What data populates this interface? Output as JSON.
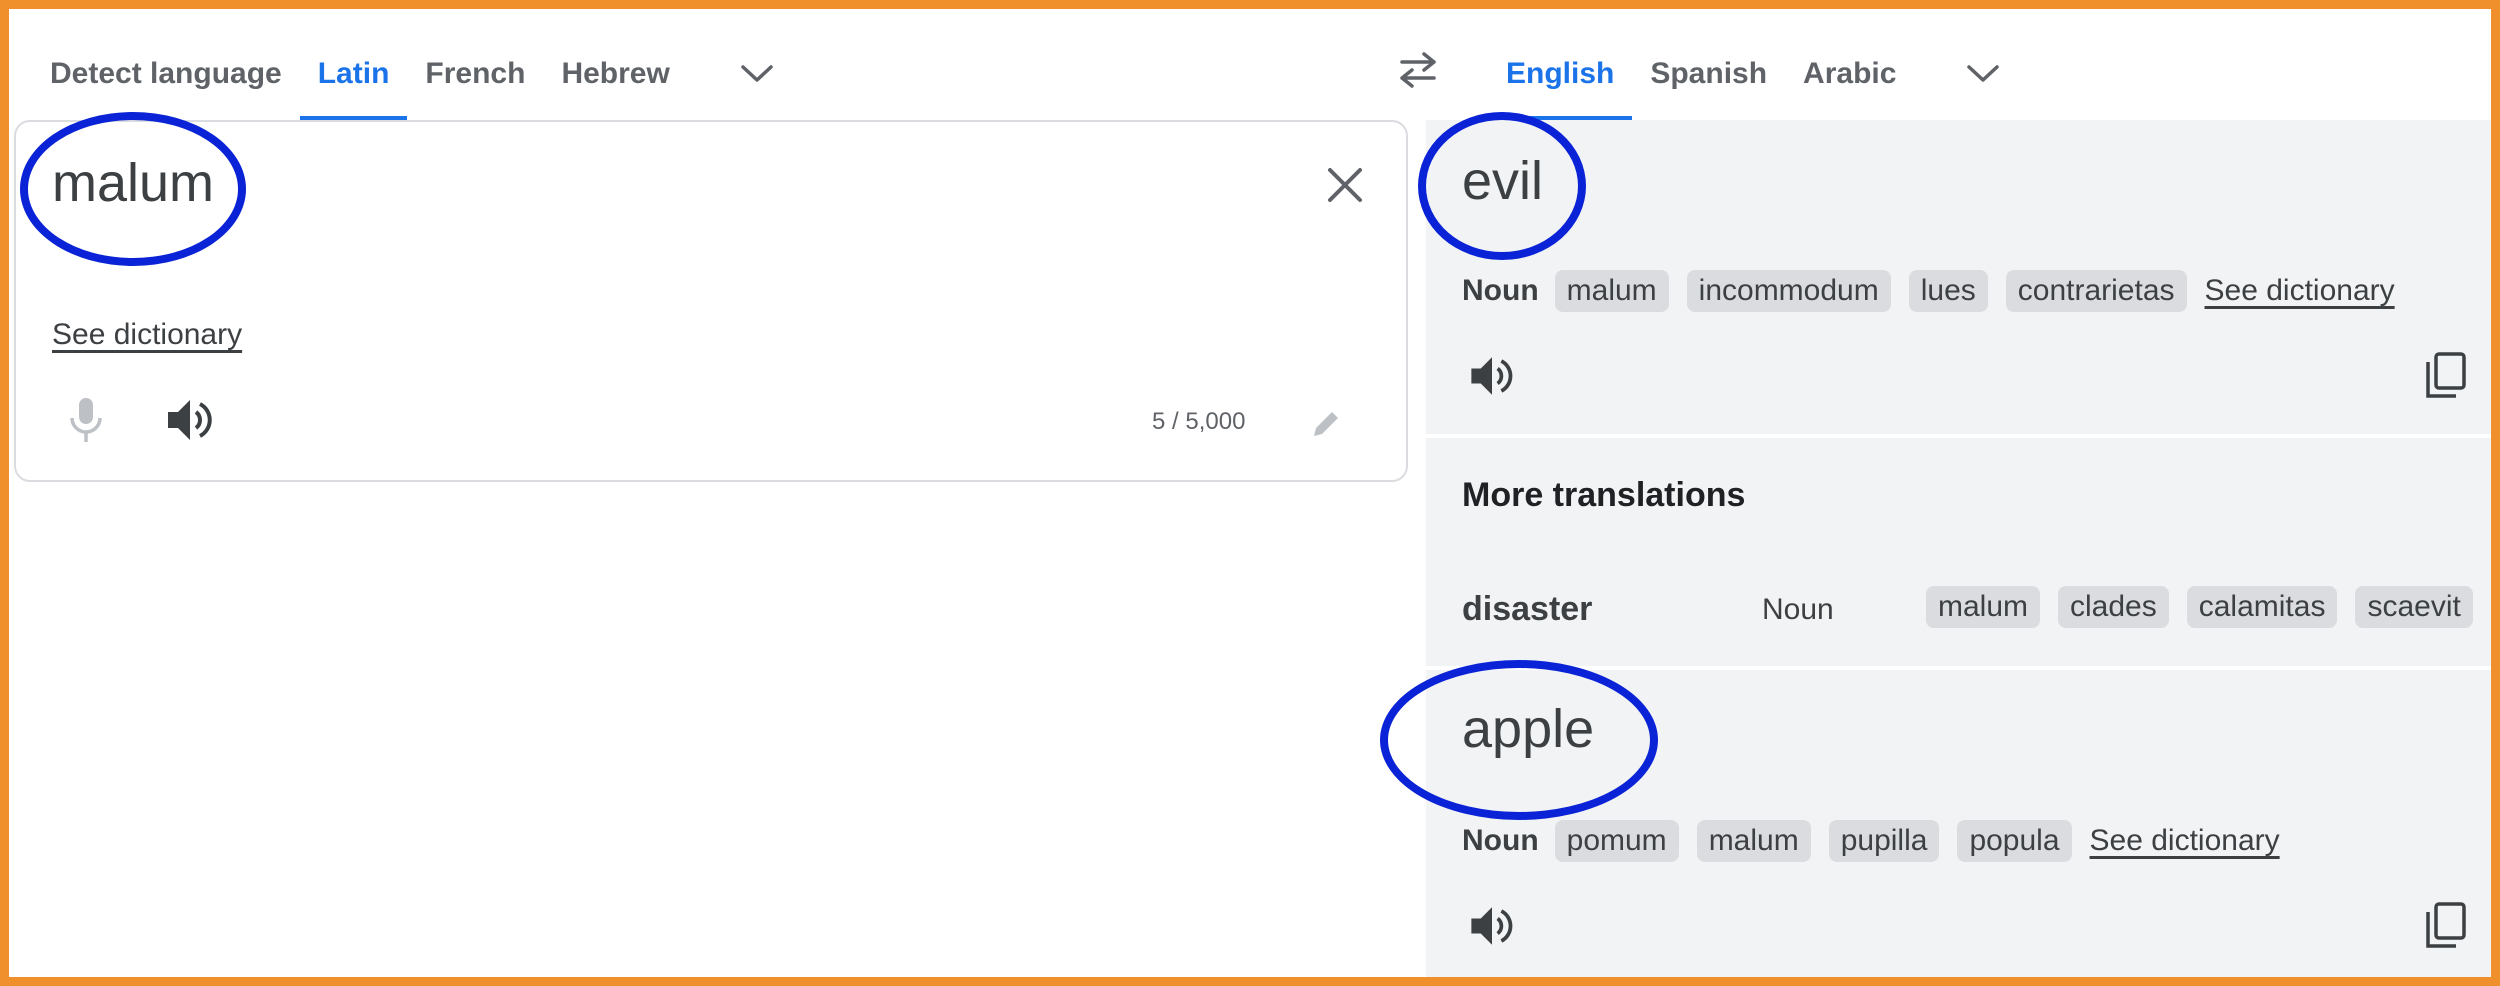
{
  "source_tabs": [
    "Detect language",
    "Latin",
    "French",
    "Hebrew"
  ],
  "source_active": 1,
  "target_tabs": [
    "English",
    "Spanish",
    "Arabic"
  ],
  "target_active": 0,
  "input": {
    "text": "malum",
    "see_dictionary": "See dictionary",
    "char_count": "5 / 5,000"
  },
  "results": [
    {
      "word": "evil",
      "pos": "Noun",
      "chips": [
        "malum",
        "incommodum",
        "lues",
        "contrarietas"
      ],
      "see_dictionary": "See dictionary"
    },
    {
      "word": "apple",
      "pos": "Noun",
      "chips": [
        "pomum",
        "malum",
        "pupilla",
        "popula"
      ],
      "see_dictionary": "See dictionary"
    }
  ],
  "more_translations": {
    "title": "More translations",
    "word": "disaster",
    "pos": "Noun",
    "chips": [
      "malum",
      "clades",
      "calamitas",
      "scaevit"
    ]
  },
  "colors": {
    "accent": "#1a73e8",
    "frame": "#f0902c",
    "annotation": "#0a23d6",
    "panel": "#f1f3f4"
  },
  "icons": [
    "chevron-down-icon",
    "swap-languages-icon",
    "clear-icon",
    "microphone-icon",
    "speaker-icon",
    "pencil-icon",
    "copy-icon"
  ]
}
